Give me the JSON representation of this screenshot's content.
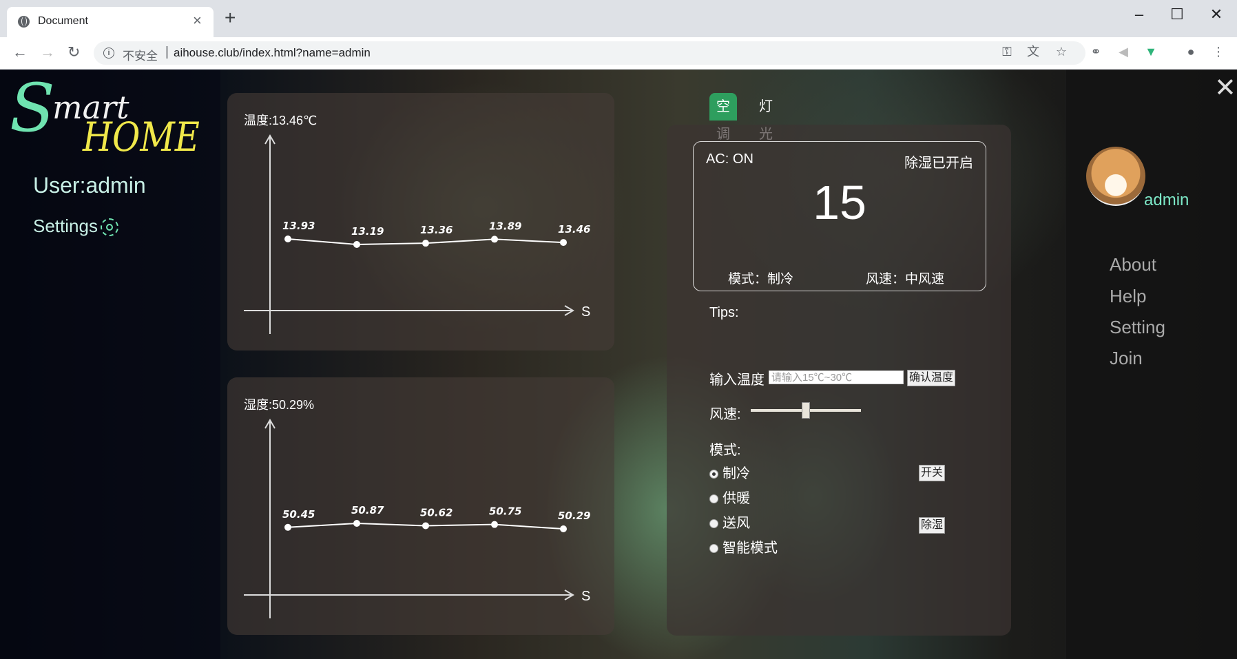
{
  "browser": {
    "tab_title": "Document",
    "tab_close": "×",
    "new_tab": "+",
    "security": "不安全",
    "url": "aihouse.club/index.html?name=admin",
    "icons": [
      "key-icon",
      "translate-icon",
      "star-icon",
      "extension-icon",
      "volume-icon",
      "vue-icon",
      "profile-icon",
      "menu-icon"
    ]
  },
  "left": {
    "logo_s": "S",
    "logo_mart": "mart",
    "logo_home": "HOME",
    "user": "User:admin",
    "settings": "Settings"
  },
  "temp_chart": {
    "title": "温度:13.46℃",
    "axis_x_label": "S",
    "chart_data": {
      "type": "line",
      "values": [
        13.93,
        13.19,
        13.36,
        13.89,
        13.46
      ]
    }
  },
  "hum_chart": {
    "title": "湿度:50.29%",
    "axis_x_label": "S",
    "chart_data": {
      "type": "line",
      "values": [
        50.45,
        50.87,
        50.62,
        50.75,
        50.29
      ]
    }
  },
  "ac": {
    "tabs": [
      "空调",
      "灯光"
    ],
    "status": "AC: ON",
    "dehum_status": "除湿已开启",
    "temperature": "15",
    "mode_text": "模式：制冷",
    "wind_text": "风速：中风速",
    "tips": "Tips:",
    "input_label": "输入温度",
    "input_placeholder": "请输入15℃~30℃",
    "confirm": "确认温度",
    "wind_label": "风速:",
    "wind_level": 0.5,
    "mode_label": "模式:",
    "modes": [
      "制冷",
      "供暖",
      "送风",
      "智能模式"
    ],
    "selected_mode": "制冷",
    "power_btn": "开关",
    "dehum_btn": "除湿"
  },
  "right": {
    "close": "✕",
    "username": "admin",
    "menu": [
      "About",
      "Help",
      "Setting",
      "Join"
    ]
  },
  "chart_data": [
    {
      "type": "line",
      "title": "温度:13.46℃",
      "xlabel": "S",
      "x": [
        1,
        2,
        3,
        4,
        5
      ],
      "values": [
        13.93,
        13.19,
        13.36,
        13.89,
        13.46
      ]
    },
    {
      "type": "line",
      "title": "湿度:50.29%",
      "xlabel": "S",
      "x": [
        1,
        2,
        3,
        4,
        5
      ],
      "values": [
        50.45,
        50.87,
        50.62,
        50.75,
        50.29
      ]
    }
  ]
}
